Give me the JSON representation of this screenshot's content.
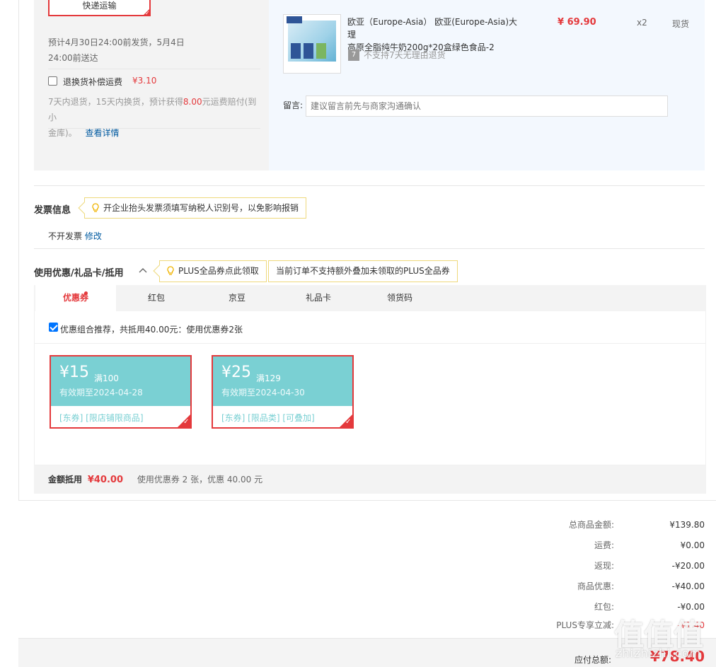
{
  "shipping": {
    "method_button": "快递运输",
    "delivery_line1": "预计4月30日24:00前发货，5月4日",
    "delivery_line2": "24:00前送达",
    "insurance_label": "退换货补偿运费",
    "insurance_price": "¥3.10",
    "insurance_desc_a": "7天内退货，15天内换货，预计获得",
    "insurance_desc_amount": "8.00",
    "insurance_desc_b": "元运费赔付(到小",
    "insurance_desc_c": "金库)。",
    "details_link": "查看详情"
  },
  "product": {
    "name_line1": "欧亚（Europe-Asia） 欧亚(Europe-Asia)大理",
    "name_line2": "高原全脂纯牛奶200g*20盒绿色食品-2",
    "price": "¥ 69.90",
    "quantity": "x2",
    "stock": "现货",
    "return_icon": "7",
    "return_policy": "不支持7天无理由退货",
    "memo_label": "留言:",
    "memo_placeholder": "建议留言前先与商家沟通确认"
  },
  "invoice": {
    "title": "发票信息",
    "tip": "开企业抬头发票须填写纳税人识别号，以免影响报销",
    "status": "不开发票",
    "modify_link": "修改"
  },
  "discount": {
    "title": "使用优惠/礼品卡/抵用",
    "tip1": "PLUS全品券点此领取",
    "tip2": "当前订单不支持额外叠加未领取的PLUS全品券",
    "tabs": [
      "优惠券",
      "红包",
      "京豆",
      "礼品卡",
      "领货码"
    ],
    "combo_label": "优惠组合推荐，共抵用40.00元：使用优惠券2张",
    "coupons": [
      {
        "amount": "¥15",
        "condition": "满100",
        "expiry": "有效期至2024-04-28",
        "tags": "[东券]  [限店铺限商品]"
      },
      {
        "amount": "¥25",
        "condition": "满129",
        "expiry": "有效期至2024-04-30",
        "tags": "[东券]  [限品类]  [可叠加]"
      }
    ],
    "summary_label": "金额抵用",
    "summary_amount": "¥40.00",
    "summary_desc": "使用优惠券 2 张，优惠 40.00 元"
  },
  "totals": [
    {
      "label": "总商品金额:",
      "value": "¥139.80"
    },
    {
      "label": "运费:",
      "value": "¥0.00"
    },
    {
      "label": "返现:",
      "value": "-¥20.00"
    },
    {
      "label": "商品优惠:",
      "value": "-¥40.00"
    },
    {
      "label": "红包:",
      "value": "-¥0.00"
    },
    {
      "label": "PLUS专享立减:",
      "value": "-¥1.40"
    }
  ],
  "payable": {
    "label": "应付总额:",
    "amount": "¥78.40"
  },
  "watermark": {
    "glyphs": "值值值",
    "text": "zhizhizhi.com"
  },
  "colors": {
    "accent_red": "#e4393c",
    "coupon_teal": "#7ad0d3",
    "link_blue": "#005aa0",
    "tip_border": "#eed97c"
  }
}
